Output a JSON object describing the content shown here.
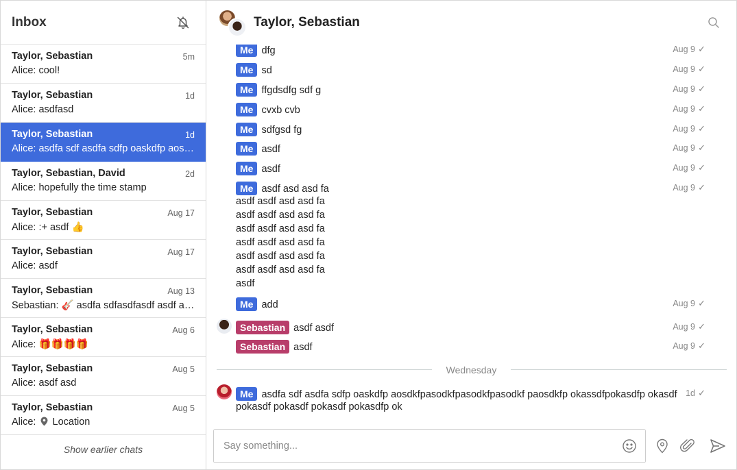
{
  "sidebar": {
    "title": "Inbox",
    "chats": [
      {
        "name": "Taylor, Sebastian",
        "time": "5m",
        "preview": "Alice: cool!"
      },
      {
        "name": "Taylor, Sebastian",
        "time": "1d",
        "preview": "Alice: asdfasd"
      },
      {
        "name": "Taylor, Sebastian",
        "time": "1d",
        "preview": "Alice: asdfa sdf asdfa sdfp oaskdfp aosdkfpasodkfpasodkfpasodkf"
      },
      {
        "name": "Taylor, Sebastian, David",
        "time": "2d",
        "preview": "Alice: hopefully the time stamp"
      },
      {
        "name": "Taylor, Sebastian",
        "time": "Aug 17",
        "preview": "Alice: :+ asdf 👍"
      },
      {
        "name": "Taylor, Sebastian",
        "time": "Aug 17",
        "preview": "Alice: asdf"
      },
      {
        "name": "Taylor, Sebastian",
        "time": "Aug 13",
        "preview": "Sebastian: 🎸 asdfa sdfasdfasdf asdf asdf asdf"
      },
      {
        "name": "Taylor, Sebastian",
        "time": "Aug 6",
        "preview": "Alice: 🎁🎁🎁🎁"
      },
      {
        "name": "Taylor, Sebastian",
        "time": "Aug 5",
        "preview": "Alice: asdf asd"
      },
      {
        "name": "Taylor, Sebastian",
        "time": "Aug 5",
        "preview_prefix": "Alice:",
        "preview_suffix": "Location"
      }
    ],
    "show_earlier": "Show earlier chats"
  },
  "conversation": {
    "title": "Taylor, Sebastian",
    "messages": [
      {
        "sender": "Me",
        "text": "dfg",
        "time": "Aug 9",
        "check": "✓"
      },
      {
        "sender": "Me",
        "text": "sd",
        "time": "Aug 9",
        "check": "✓"
      },
      {
        "sender": "Me",
        "text": "ffgdsdfg sdf g",
        "time": "Aug 9",
        "check": "✓"
      },
      {
        "sender": "Me",
        "text": "cvxb cvb",
        "time": "Aug 9",
        "check": "✓"
      },
      {
        "sender": "Me",
        "text": "sdfgsd fg",
        "time": "Aug 9",
        "check": "✓"
      },
      {
        "sender": "Me",
        "text": "asdf",
        "time": "Aug 9",
        "check": "✓"
      },
      {
        "sender": "Me",
        "text": "asdf",
        "time": "Aug 9",
        "check": "✓"
      },
      {
        "sender": "Me",
        "text": "asdf asd asd fa",
        "time": "Aug 9",
        "check": "✓"
      },
      {
        "sender": "Me",
        "text": "add",
        "time": "Aug 9",
        "check": "✓"
      },
      {
        "sender": "Sebastian",
        "text": "asdf asdf",
        "time": "Aug 9",
        "check": "✓"
      },
      {
        "sender": "Sebastian",
        "text": "asdf",
        "time": "Aug 9",
        "check": "✓"
      },
      {
        "sender": "Me",
        "text": "asdfa sdf asdfa sdfp oaskdfp aosdkfpasodkfpasodkfpasodkf paosdkfp okassdfpokasdfp okasdf",
        "time": "1d",
        "check": "✓"
      }
    ],
    "multiline": [
      "asdf asdf asd asd fa",
      "asdf asdf asd asd fa",
      "asdf asdf asd asd fa",
      "asdf asdf asd asd fa",
      "asdf asdf asd asd fa",
      "asdf asdf asd asd fa",
      "asdf"
    ],
    "last_continuation": "pokasdf pokasdf pokasdf pokasdfp ok",
    "day_divider": "Wednesday"
  },
  "composer": {
    "placeholder": "Say something..."
  },
  "colors": {
    "accent": "#3e6bdc",
    "sebastian": "#b83d6a"
  },
  "icons": [
    "bell-off-icon",
    "search-icon",
    "location-pin-icon",
    "emoji-icon",
    "paperclip-icon",
    "send-icon"
  ]
}
